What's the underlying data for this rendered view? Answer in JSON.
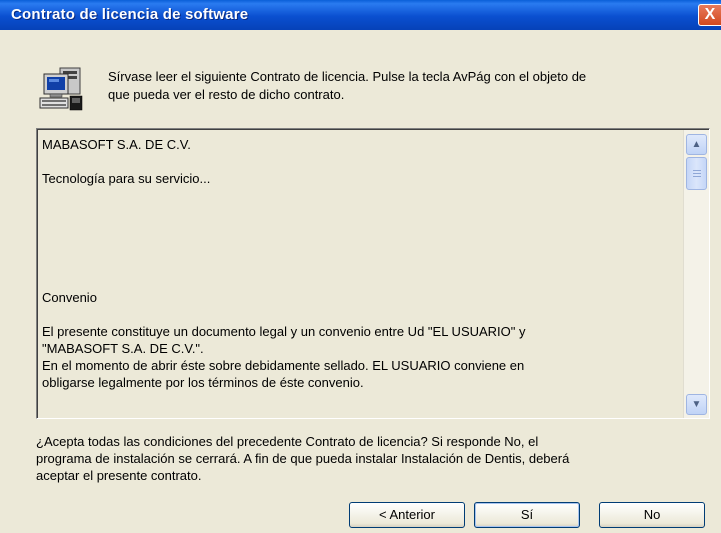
{
  "window": {
    "title": "Contrato de licencia de software",
    "close_label": "X"
  },
  "header": {
    "lines": [
      "Sírvase leer el siguiente Contrato de licencia. Pulse la tecla AvPág con el objeto de",
      "que pueda ver el resto de dicho contrato."
    ]
  },
  "license": {
    "lines": [
      "MABASOFT S.A. DE C.V.",
      "",
      "Tecnología para su servicio...",
      "",
      "",
      "",
      "",
      "",
      "",
      "Convenio",
      "",
      "El presente constituye un documento legal y un convenio entre Ud \"EL USUARIO\" y",
      "\"MABASOFT S.A. DE C.V.\".",
      "En el momento de abrir éste sobre debidamente sellado. EL USUARIO conviene en",
      "obligarse legalmente por los términos de éste convenio."
    ]
  },
  "question": {
    "lines": [
      "¿Acepta todas las condiciones del precedente Contrato de licencia? Si responde No, el",
      "programa de instalación se cerrará. A fin de que pueda instalar Instalación de Dentis, deberá",
      "aceptar el presente contrato."
    ]
  },
  "buttons": {
    "back": "< Anterior",
    "yes": "Sí",
    "no": "No"
  },
  "colors": {
    "titlebar": "#0a4fd0",
    "dialog_bg": "#ece9d8",
    "close_button": "#d2491f"
  },
  "icons": {
    "setup": "computer-setup-icon",
    "scroll_up": "chevron-up-icon",
    "scroll_down": "chevron-down-icon"
  }
}
